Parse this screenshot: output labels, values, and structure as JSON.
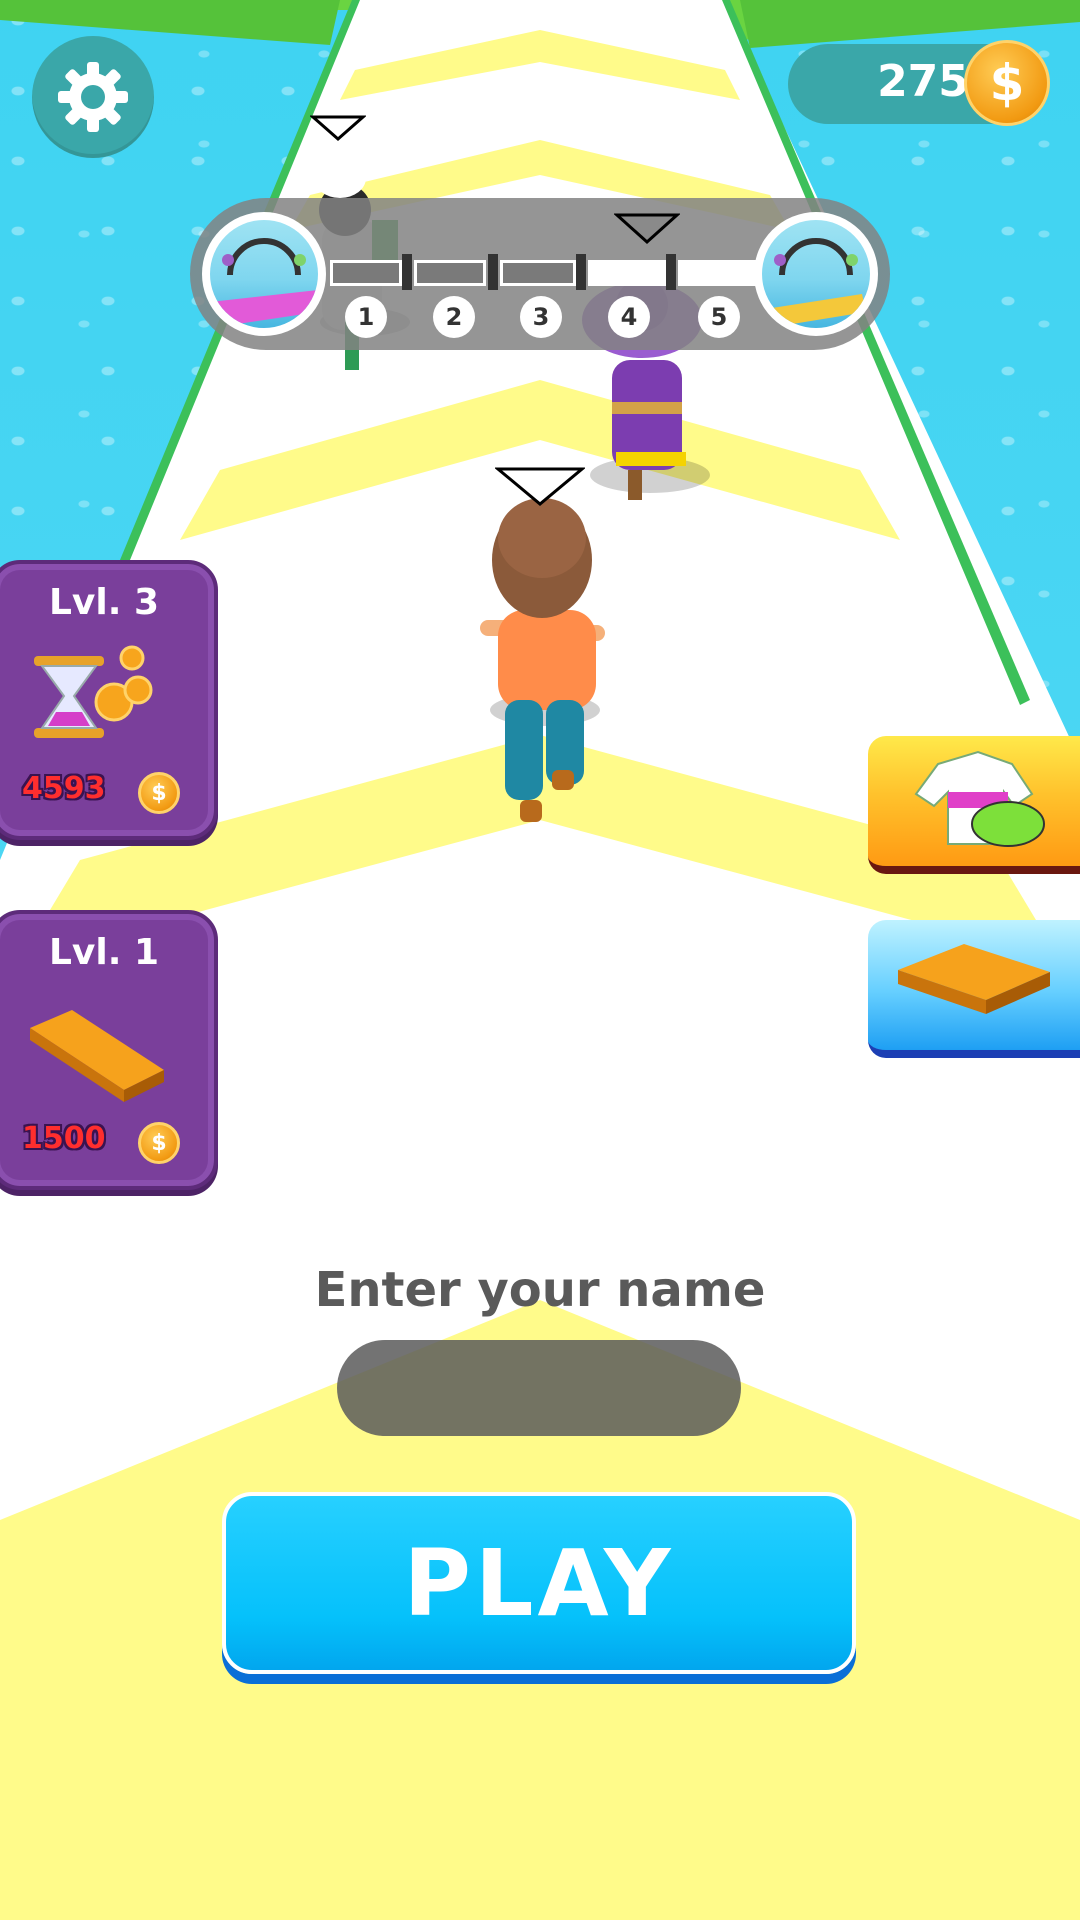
{
  "colors": {
    "water": "#4ad6f3",
    "grass": "#6ad441",
    "track_white": "#ffffff",
    "track_yellow": "#fffb8a",
    "hud_teal": "#3aa7a9",
    "card_purple": "#7a3f9b",
    "price_red": "#ff2e2e",
    "play_blue": "#05c1fb"
  },
  "hud": {
    "settings_icon": "gear-icon",
    "coins": "275",
    "coin_icon": "dollar-coin-icon"
  },
  "progress": {
    "stages": [
      "1",
      "2",
      "3",
      "4",
      "5"
    ],
    "current_stage": 4
  },
  "upgrades": [
    {
      "level": "Lvl. 3",
      "icon": "hourglass-coins-icon",
      "price": "4593"
    },
    {
      "level": "Lvl. 1",
      "icon": "plank-icon",
      "price": "1500"
    }
  ],
  "shop": {
    "skins_icon": "tshirt-icon",
    "platforms_icon": "plank-icon"
  },
  "name_entry": {
    "label": "Enter your name",
    "value": ""
  },
  "play": {
    "label": "PLAY"
  }
}
